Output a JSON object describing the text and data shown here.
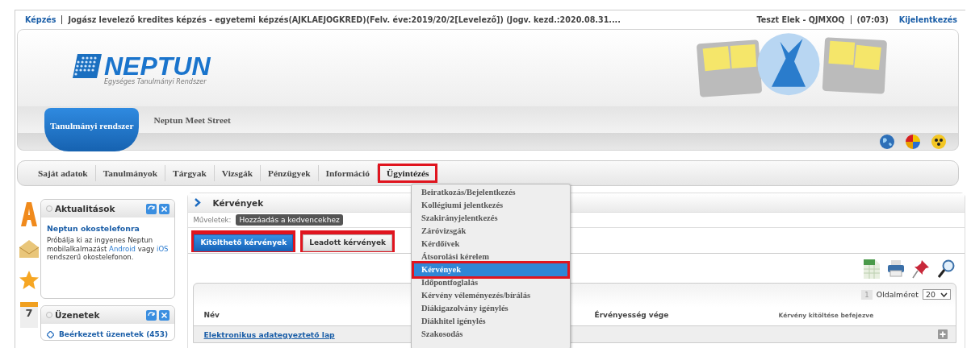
{
  "top_bar": {
    "section_link": "Képzés",
    "training": "Jogász levelező kredites képzés - egyetemi képzés(AJKLAEJOGKRED)(Felv. éve:2019/20/2[Levelező]) (Jogv. kezd.:2020.08.31....",
    "user": "Teszt Elek - QJMXOQ",
    "session_time": "(07:03)",
    "logout": "Kijelentkezés"
  },
  "logo": {
    "name": "NEPTUN",
    "subtitle": "Egységes Tanulmányi Rendszer"
  },
  "system_tabs": [
    {
      "label": "Tanulmányi rendszer",
      "selected": true
    },
    {
      "label": "Neptun Meet Street",
      "selected": false
    }
  ],
  "main_menu": [
    {
      "label": "Saját adatok",
      "highlighted": false
    },
    {
      "label": "Tanulmányok",
      "highlighted": false
    },
    {
      "label": "Tárgyak",
      "highlighted": false
    },
    {
      "label": "Vizsgák",
      "highlighted": false
    },
    {
      "label": "Pénzügyek",
      "highlighted": false
    },
    {
      "label": "Információ",
      "highlighted": false
    },
    {
      "label": "Ügyintézés",
      "highlighted": true
    }
  ],
  "dropdown": [
    {
      "label": "Beiratkozás/Bejelentkezés",
      "selected": false
    },
    {
      "label": "Kollégiumi jelentkezés",
      "selected": false
    },
    {
      "label": "Szakirányjelentkezés",
      "selected": false
    },
    {
      "label": "Záróvizsgák",
      "selected": false
    },
    {
      "label": "Kérdőívek",
      "selected": false
    },
    {
      "label": "Átsorolási kérelem",
      "selected": false
    },
    {
      "label": "Kérvények",
      "selected": true
    },
    {
      "label": "Időpontfoglalás",
      "selected": false
    },
    {
      "label": "Kérvény véleményezés/bírálás",
      "selected": false
    },
    {
      "label": "Diákigazolvány igénylés",
      "selected": false
    },
    {
      "label": "Diákhitel igénylés",
      "selected": false
    },
    {
      "label": "Szakosodás",
      "selected": false
    }
  ],
  "sidebar": {
    "calendar_day": "7",
    "panels": [
      {
        "kind": "news",
        "title": "Aktualitások",
        "news_title": "Neptun okostelefonra",
        "body": [
          {
            "text": "Próbálja ki az ingyenes Neptun mobilalkalmazást ",
            "link": false
          },
          {
            "text": "Android",
            "link": true
          },
          {
            "text": " vagy ",
            "link": false
          },
          {
            "text": "iOS",
            "link": true
          },
          {
            "text": " rendszerű okostelefonon.",
            "link": false
          }
        ]
      },
      {
        "kind": "links",
        "title": "Üzenetek",
        "items": [
          "Beérkezett üzenetek (453)"
        ]
      }
    ]
  },
  "page": {
    "title": "Kérvények",
    "operations_label": "Műveletek:",
    "operations": [
      "Hozzáadás a kedvencekhez"
    ],
    "buttons": [
      {
        "label": "Kitölthető kérvények",
        "selected": true,
        "highlighted": true
      },
      {
        "label": "Leadott kérvények",
        "selected": false,
        "highlighted": true
      }
    ]
  },
  "table": {
    "page_number": "1",
    "page_size_label": "Oldalméret",
    "page_size": "20",
    "columns": [
      "Név",
      "Érvényesség vége",
      "Kérvény kitöltése befejezve"
    ],
    "rows": [
      {
        "name": "Elektronikus adategyeztető lap"
      }
    ]
  }
}
